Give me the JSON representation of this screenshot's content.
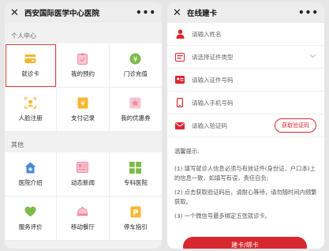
{
  "left": {
    "title": "西安国际医学中心医院",
    "personal_label": "个人中心",
    "personal_items": [
      {
        "label": "就诊卡",
        "icon": "card-icon",
        "color": "#f5b731"
      },
      {
        "label": "我的预约",
        "icon": "clipboard-icon",
        "color": "#f08aa0"
      },
      {
        "label": "门诊充值",
        "icon": "yuan-icon",
        "color": "#7dbb4b"
      },
      {
        "label": "人脸注册",
        "icon": "face-icon",
        "color": "#f5b731"
      },
      {
        "label": "支付记录",
        "icon": "payment-icon",
        "color": "#f5b731"
      },
      {
        "label": "我的优惠券",
        "icon": "coupon-icon",
        "color": "#f08aa0"
      }
    ],
    "other_label": "其他",
    "other_items": [
      {
        "label": "医院介绍",
        "icon": "hospital-icon",
        "color": "#4a8ad6"
      },
      {
        "label": "动态新闻",
        "icon": "news-icon",
        "color": "#f08aa0"
      },
      {
        "label": "专科医院",
        "icon": "grid-icon",
        "color": "#7dbb4b"
      },
      {
        "label": "服务评价",
        "icon": "heart-icon",
        "color": "#7dbb4b"
      },
      {
        "label": "移动餐厅",
        "icon": "dish-icon",
        "color": "#f08aa0"
      },
      {
        "label": "停车指引",
        "icon": "parking-icon",
        "color": "#f5b731"
      }
    ]
  },
  "right": {
    "title": "在线建卡",
    "fields": [
      {
        "placeholder": "请输入姓名",
        "icon": "person-icon"
      },
      {
        "placeholder": "请选择证件类型",
        "icon": "id-type-icon"
      },
      {
        "placeholder": "请输入证件号码",
        "icon": "id-card-icon"
      },
      {
        "placeholder": "请输入手机号码",
        "icon": "phone-icon"
      },
      {
        "placeholder": "请输入验证码",
        "icon": "mail-icon"
      }
    ],
    "get_code_label": "获取验证码",
    "tips_title": "温馨提示:",
    "tips": [
      "(1) 填写就诊人信息必须与有效证件(身份证、户口本)上的信息一致，如填写有误，责任自负;",
      "(2) 点击获取验证码后，请耐心等待，请勿随时间内频繁获取。",
      "(3) 一个微信号最多绑定五张就诊卡。"
    ],
    "submit_label": "建卡/绑卡",
    "accent": "#d8282f"
  }
}
